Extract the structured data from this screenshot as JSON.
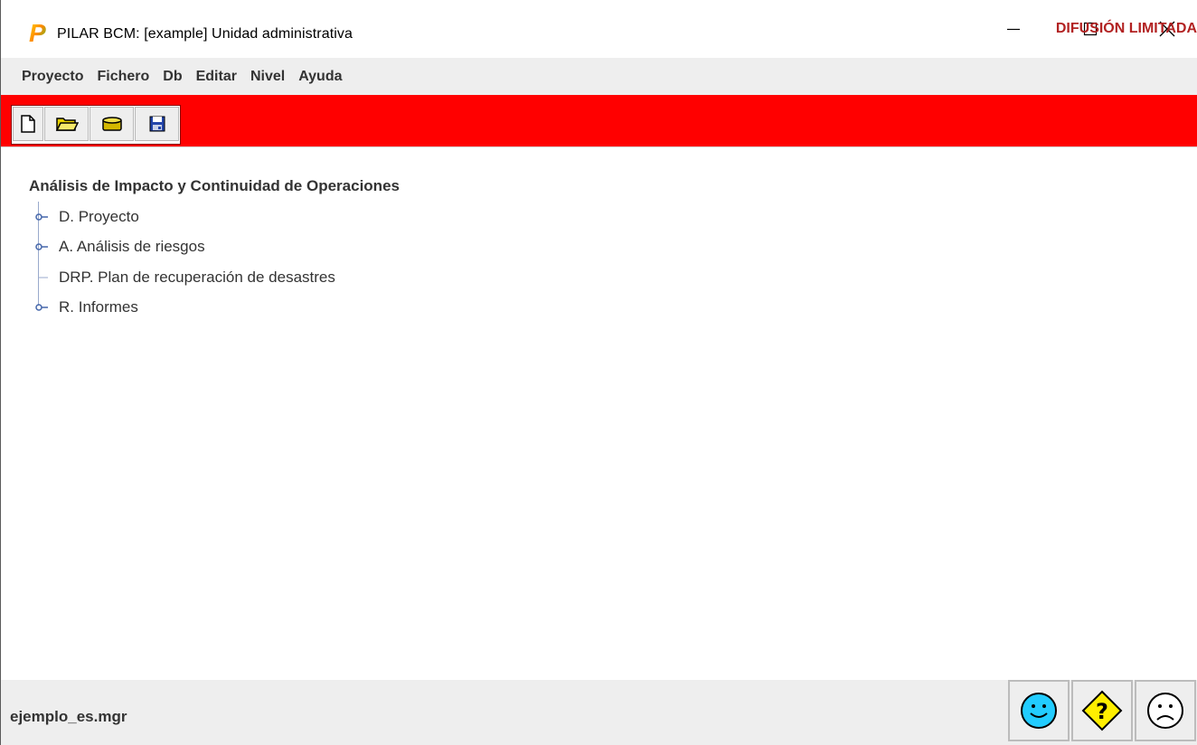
{
  "window": {
    "title": "PILAR BCM: [example] Unidad administrativa",
    "logo_letter": "P"
  },
  "menu": {
    "items": [
      {
        "label": "Proyecto"
      },
      {
        "label": "Fichero"
      },
      {
        "label": "Db"
      },
      {
        "label": "Editar"
      },
      {
        "label": "Nivel"
      },
      {
        "label": "Ayuda"
      }
    ]
  },
  "toolbar": {
    "background_color": "#ff0000",
    "buttons": [
      {
        "icon": "new-document-icon"
      },
      {
        "icon": "open-folder-icon"
      },
      {
        "icon": "database-icon"
      },
      {
        "icon": "save-icon"
      }
    ],
    "classification_label": "DIFUSIÓN LIMITADA"
  },
  "tree": {
    "root_label": "Análisis de Impacto y Continuidad de Operaciones",
    "nodes": [
      {
        "label": "D. Proyecto",
        "expandable": true
      },
      {
        "label": "A. Análisis de riesgos",
        "expandable": true
      },
      {
        "label": "DRP. Plan de recuperación de desastres",
        "expandable": false
      },
      {
        "label": "R. Informes",
        "expandable": true
      }
    ]
  },
  "status": {
    "filename": "ejemplo_es.mgr",
    "buttons": [
      {
        "icon": "happy-face-icon"
      },
      {
        "icon": "question-sign-icon"
      },
      {
        "icon": "sad-face-icon"
      }
    ]
  }
}
